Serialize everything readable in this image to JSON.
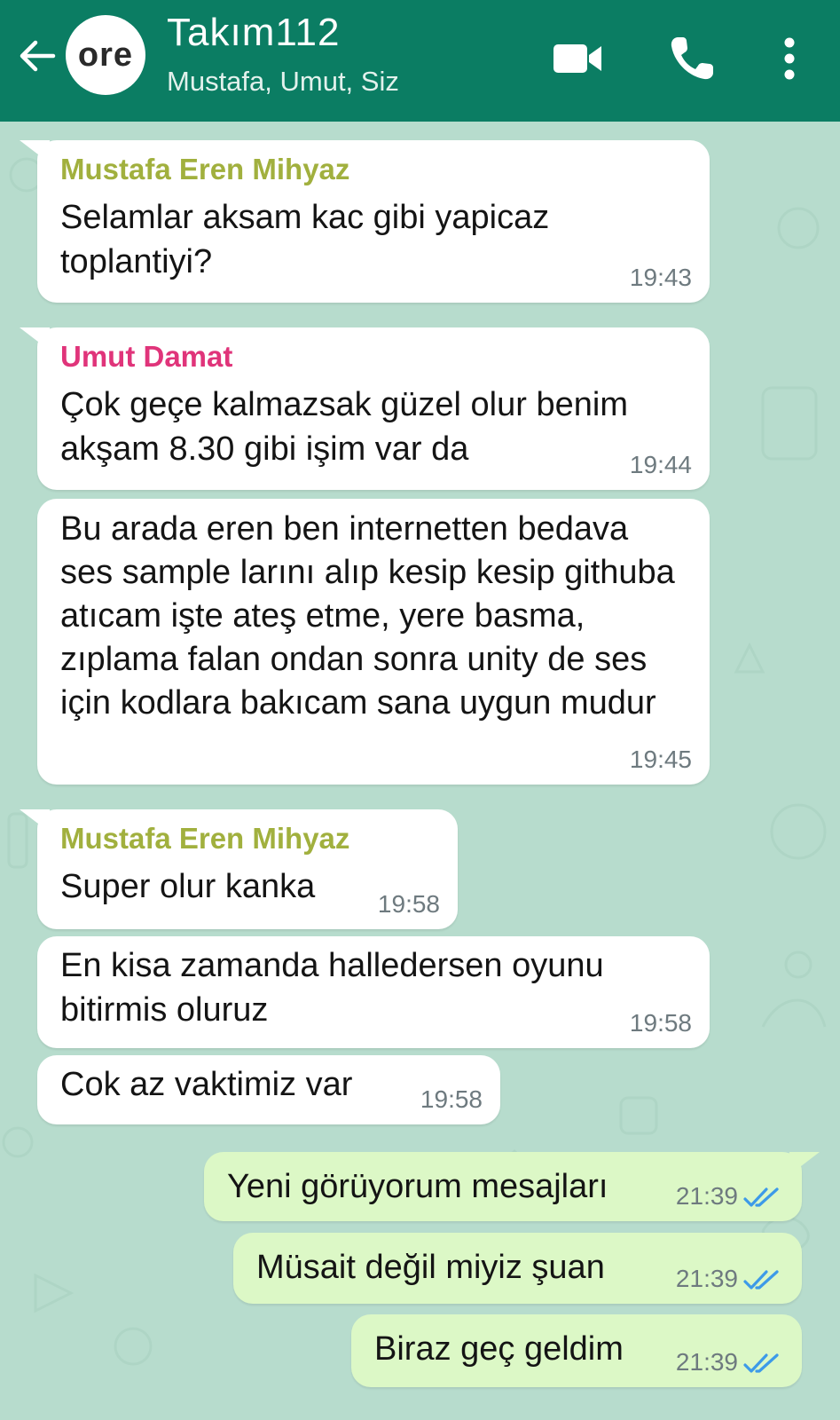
{
  "header": {
    "avatar_text": "ore",
    "title": "Takım112",
    "subtitle": "Mustafa, Umut, Siz",
    "icons": [
      "back-arrow-icon",
      "video-call-icon",
      "phone-icon",
      "more-vert-icon"
    ],
    "background": "#0b7d63"
  },
  "messages": [
    {
      "sender": "Mustafa Eren Mihyaz",
      "sender_color": "#a1b03e",
      "text": "Selamlar aksam kac gibi yapicaz toplantiyi?",
      "time": "19:43"
    },
    {
      "sender": "Umut Damat",
      "sender_color": "#e0347a",
      "text": "Çok geçe kalmazsak güzel olur benim akşam 8.30 gibi işim var da",
      "time": "19:44"
    },
    {
      "text": "Bu arada eren ben internetten bedava ses sample larını alıp kesip kesip githuba atıcam işte ateş etme, yere basma, zıplama falan ondan sonra unity de ses için kodlara bakıcam sana uygun mudur",
      "time": "19:45"
    },
    {
      "sender": "Mustafa Eren Mihyaz",
      "sender_color": "#a1b03e",
      "text": "Super olur kanka",
      "time": "19:58"
    },
    {
      "text": "En kisa zamanda halledersen oyunu bitirmis oluruz",
      "time": "19:58"
    },
    {
      "text": "Cok az vaktimiz var",
      "time": "19:58"
    },
    {
      "text": "Yeni görüyorum mesajları",
      "time": "21:39",
      "outgoing": true
    },
    {
      "text": "Müsait değil miyiz şuan",
      "time": "21:39",
      "outgoing": true
    },
    {
      "text": "Biraz geç geldim",
      "time": "21:39",
      "outgoing": true
    }
  ],
  "colors": {
    "chat_background": "#b7dccd",
    "incoming_bubble": "#ffffff",
    "outgoing_bubble": "#dcf8c6",
    "read_ticks": "#3d9ae8"
  }
}
